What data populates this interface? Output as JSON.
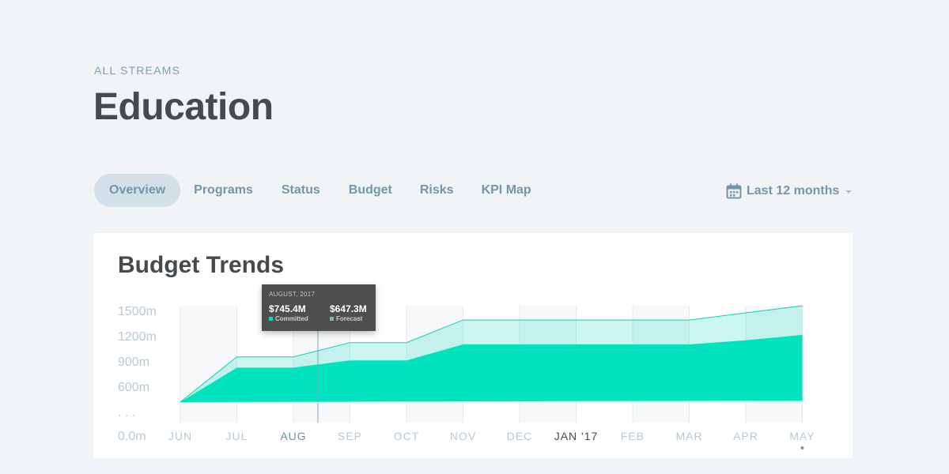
{
  "breadcrumb": "ALL STREAMS",
  "title": "Education",
  "tabs": [
    {
      "label": "Overview",
      "active": true
    },
    {
      "label": "Programs",
      "active": false
    },
    {
      "label": "Status",
      "active": false
    },
    {
      "label": "Budget",
      "active": false
    },
    {
      "label": "Risks",
      "active": false
    },
    {
      "label": "KPI Map",
      "active": false
    }
  ],
  "date_filter": {
    "label": "Last 12 months",
    "icon": "calendar-icon"
  },
  "card": {
    "title": "Budget Trends"
  },
  "tooltip": {
    "date": "AUGUST, 2017",
    "committed_value": "$745.4M",
    "committed_label": "Committed",
    "forecast_value": "$647.3M",
    "forecast_label": "Forecast"
  },
  "colors": {
    "accent": "#00e0bd",
    "forecast_fill": "#cdf4ee",
    "text_dark": "#454a4f",
    "text_blue": "#7296ab"
  },
  "chart_data": {
    "type": "area",
    "categories": [
      "JUN",
      "JUL",
      "AUG",
      "SEP",
      "OCT",
      "NOV",
      "DEC",
      "JAN '17",
      "FEB",
      "MAR",
      "APR",
      "MAY"
    ],
    "highlighted_categories": [
      "AUG",
      "JAN '17"
    ],
    "y_tick_labels": [
      "1500m",
      "1200m",
      "900m",
      "600m",
      ". . .",
      "0.0m"
    ],
    "series": [
      {
        "values": [
          0,
          760,
          760,
          1000,
          1000,
          1380,
          1380,
          1380,
          1380,
          1380,
          1500,
          1620
        ]
      },
      {
        "values": [
          0,
          580,
          580,
          700,
          700,
          970,
          970,
          970,
          970,
          970,
          1040,
          1130
        ]
      }
    ]
  }
}
